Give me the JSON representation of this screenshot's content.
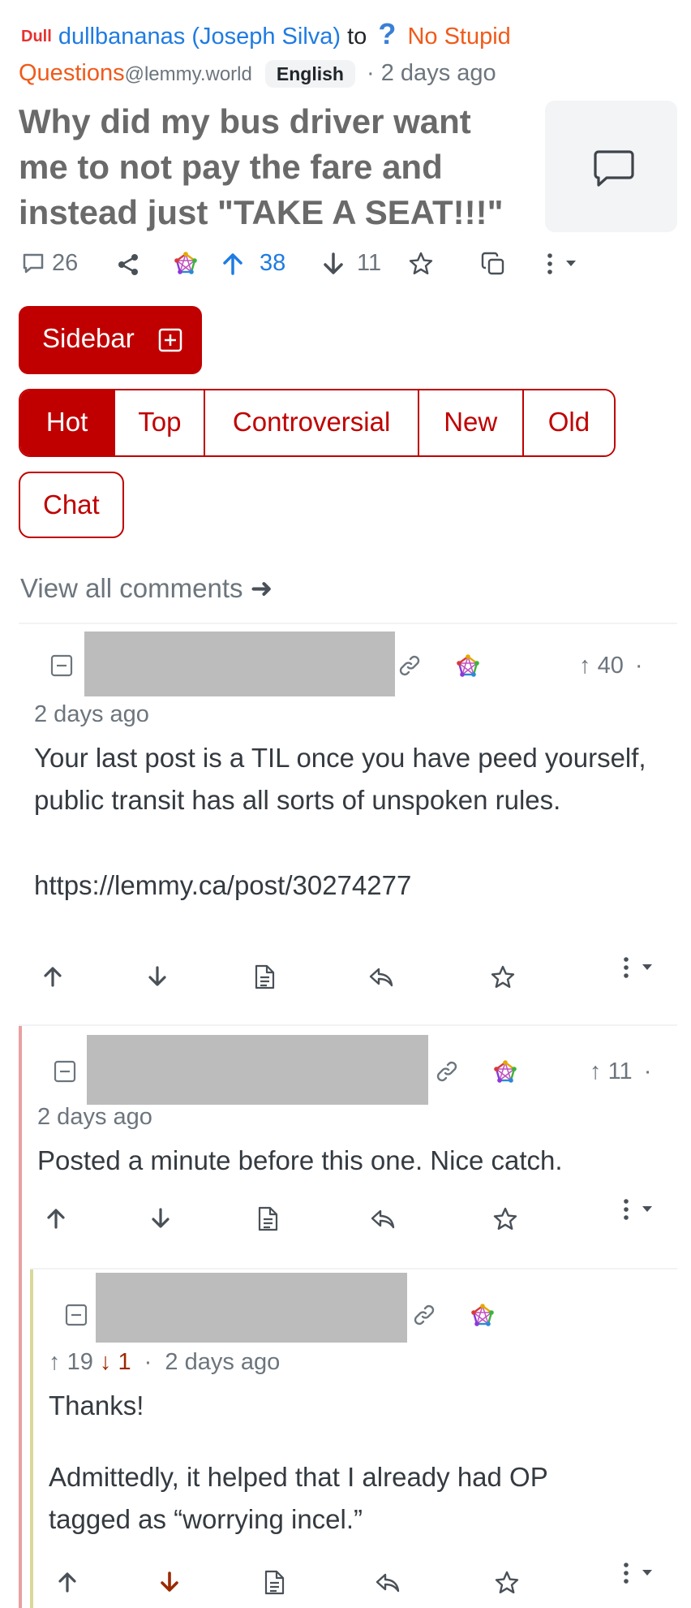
{
  "post": {
    "author_badge": "Dull",
    "author": "dullbananas (Joseph Silva)",
    "to_word": "to",
    "community_icon": "?",
    "community_line1": "No Stupid",
    "community_line2": "Questions",
    "community_instance": "@lemmy.world",
    "language": "English",
    "time": "· 2 days ago",
    "title": "Why did my bus driver want me to not pay the fare and instead just \"TAKE A SEAT!!!\"",
    "comment_count": "26",
    "upvotes": "38",
    "downvotes": "11"
  },
  "sidebar_button": "Sidebar",
  "sort_tabs": [
    "Hot",
    "Top",
    "Controversial",
    "New",
    "Old"
  ],
  "active_sort": "Hot",
  "chat_button": "Chat",
  "view_all": "View all comments",
  "comments": [
    {
      "score": "40",
      "time": "2 days ago",
      "body": "Your last post is a TIL once you have peed yourself, public transit has all sorts of unspoken rules.",
      "link": "https://lemmy.ca/post/30274277"
    },
    {
      "score": "11",
      "time": "2 days ago",
      "body": "Posted a minute before this one. Nice catch."
    },
    {
      "up": "19",
      "down": "1",
      "time": "2 days ago",
      "body_p1": "Thanks!",
      "body_p2": "Admittedly, it helped that I already had OP tagged as “worrying incel.”"
    }
  ],
  "colors": {
    "accent": "#c00000",
    "link": "#1f7be2",
    "community": "#f05a1a",
    "thread_level1": "#e8a0a0",
    "thread_level2": "#d8d89a",
    "downvoted": "#9a2a00"
  }
}
